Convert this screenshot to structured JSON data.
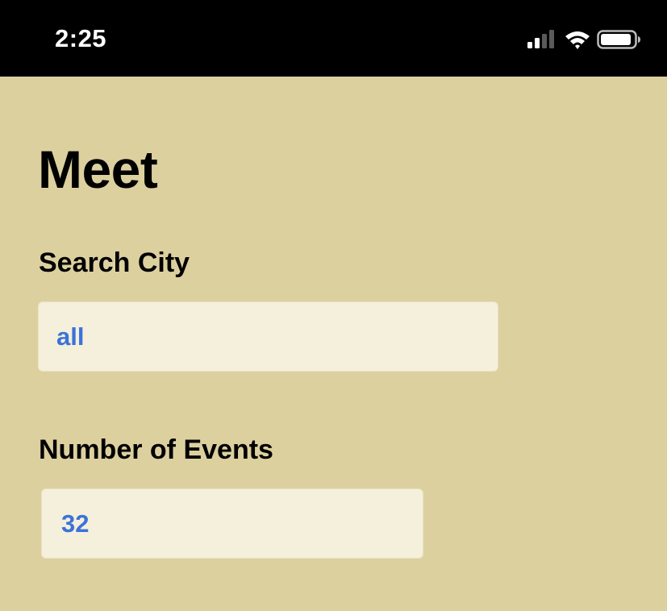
{
  "status_bar": {
    "time": "2:25",
    "icons": [
      "signal-icon",
      "wifi-icon",
      "battery-icon"
    ],
    "background": "#000000",
    "foreground": "#ffffff"
  },
  "app": {
    "title": "Meet",
    "background": "#ddd09f"
  },
  "city_search": {
    "label": "Search City",
    "value": "all"
  },
  "event_count": {
    "label": "Number of Events",
    "value": "32"
  },
  "colors": {
    "input_background": "#f5f0dc",
    "input_text": "#3a73d9"
  }
}
